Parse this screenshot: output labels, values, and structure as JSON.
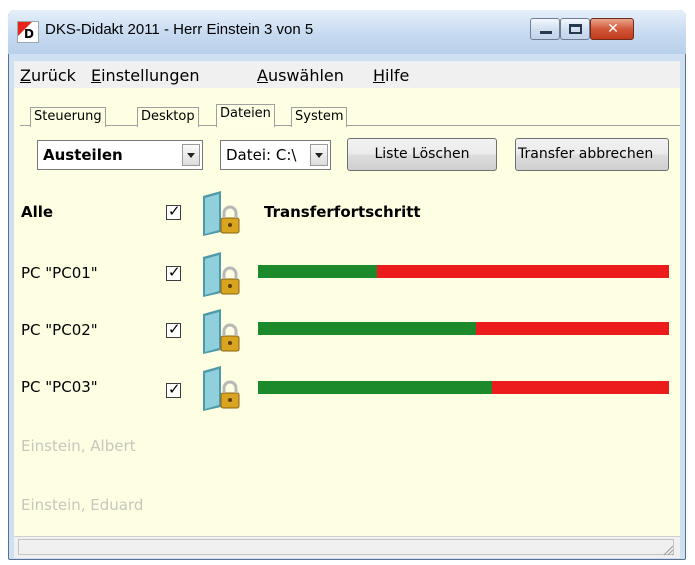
{
  "window": {
    "title": "DKS-Didakt 2011 - Herr Einstein  3 von 5",
    "icon_letter": "D"
  },
  "menu": {
    "items": [
      {
        "accel": "Z",
        "rest": "urück"
      },
      {
        "accel": "E",
        "rest": "instellungen"
      },
      {
        "accel": "A",
        "rest": "uswählen"
      },
      {
        "accel": "H",
        "rest": "ilfe"
      }
    ]
  },
  "tabs": [
    {
      "label": "Steuerung",
      "active": false
    },
    {
      "label": "Desktop",
      "active": false
    },
    {
      "label": "Dateien",
      "active": true
    },
    {
      "label": "System",
      "active": false
    }
  ],
  "toolbar": {
    "mode_value": "Austeilen",
    "file_value": "Datei: C:\\",
    "clear_label": "Liste Löschen",
    "abort_label": "Transfer abbrechen"
  },
  "header_row": {
    "label": "Alle",
    "checked": true,
    "progress_title": "Transferfortschritt"
  },
  "rows": [
    {
      "label": "PC \"PC01\"",
      "checked": true,
      "progress": 0.29
    },
    {
      "label": "PC \"PC02\"",
      "checked": true,
      "progress": 0.53
    },
    {
      "label": "PC \"PC03\"",
      "checked": true,
      "progress": 0.57
    }
  ],
  "disabled_users": [
    {
      "label": "Einstein, Albert"
    },
    {
      "label": "Einstein, Eduard"
    }
  ],
  "colors": {
    "progress_done": "#1c8a2a",
    "progress_remaining": "#ec1c1c",
    "client_background": "#fefee2"
  },
  "icons": {
    "lock": "folder-lock-icon"
  }
}
